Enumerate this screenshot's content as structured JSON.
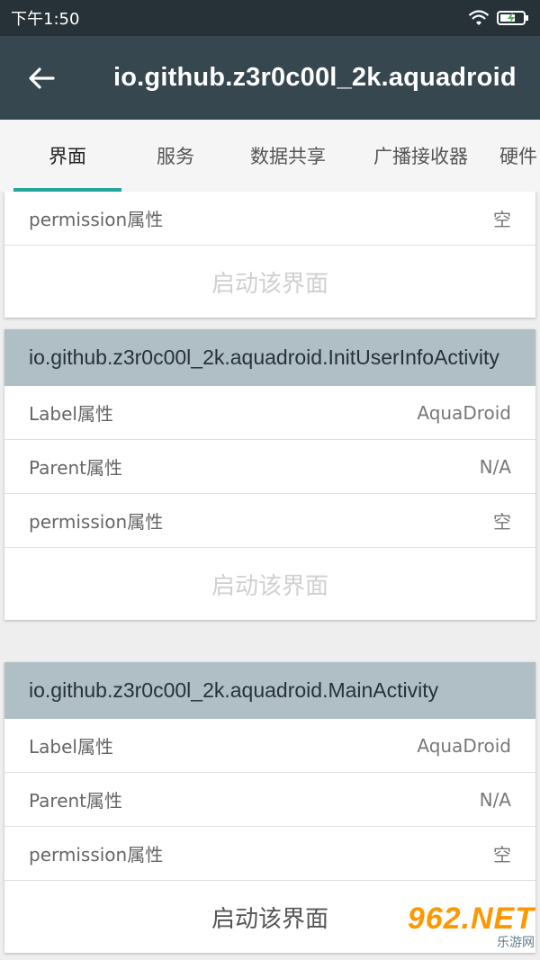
{
  "status": {
    "time": "下午1:50"
  },
  "appbar": {
    "title": "io.github.z3r0c00l_2k.aquadroid"
  },
  "tabs": [
    {
      "label": "界面"
    },
    {
      "label": "服务"
    },
    {
      "label": "数据共享"
    },
    {
      "label": "广播接收器"
    },
    {
      "label": "硬件"
    }
  ],
  "card0": {
    "rows": [
      {
        "key": "permission属性",
        "value": "空"
      }
    ],
    "launch": "启动该界面"
  },
  "card1": {
    "title": "io.github.z3r0c00l_2k.aquadroid.InitUserInfoActivity",
    "rows": [
      {
        "key": "Label属性",
        "value": "AquaDroid"
      },
      {
        "key": "Parent属性",
        "value": "N/A"
      },
      {
        "key": "permission属性",
        "value": "空"
      }
    ],
    "launch": "启动该界面"
  },
  "card2": {
    "title": "io.github.z3r0c00l_2k.aquadroid.MainActivity",
    "rows": [
      {
        "key": "Label属性",
        "value": "AquaDroid"
      },
      {
        "key": "Parent属性",
        "value": "N/A"
      },
      {
        "key": "permission属性",
        "value": "空"
      }
    ],
    "launch": "启动该界面"
  },
  "watermark": {
    "number": "962.NET",
    "sub": "乐游网"
  },
  "colors": {
    "appbar": "#37474f",
    "statusbar": "#263238",
    "accent": "#26a69a",
    "card_header": "#b0bec5"
  }
}
